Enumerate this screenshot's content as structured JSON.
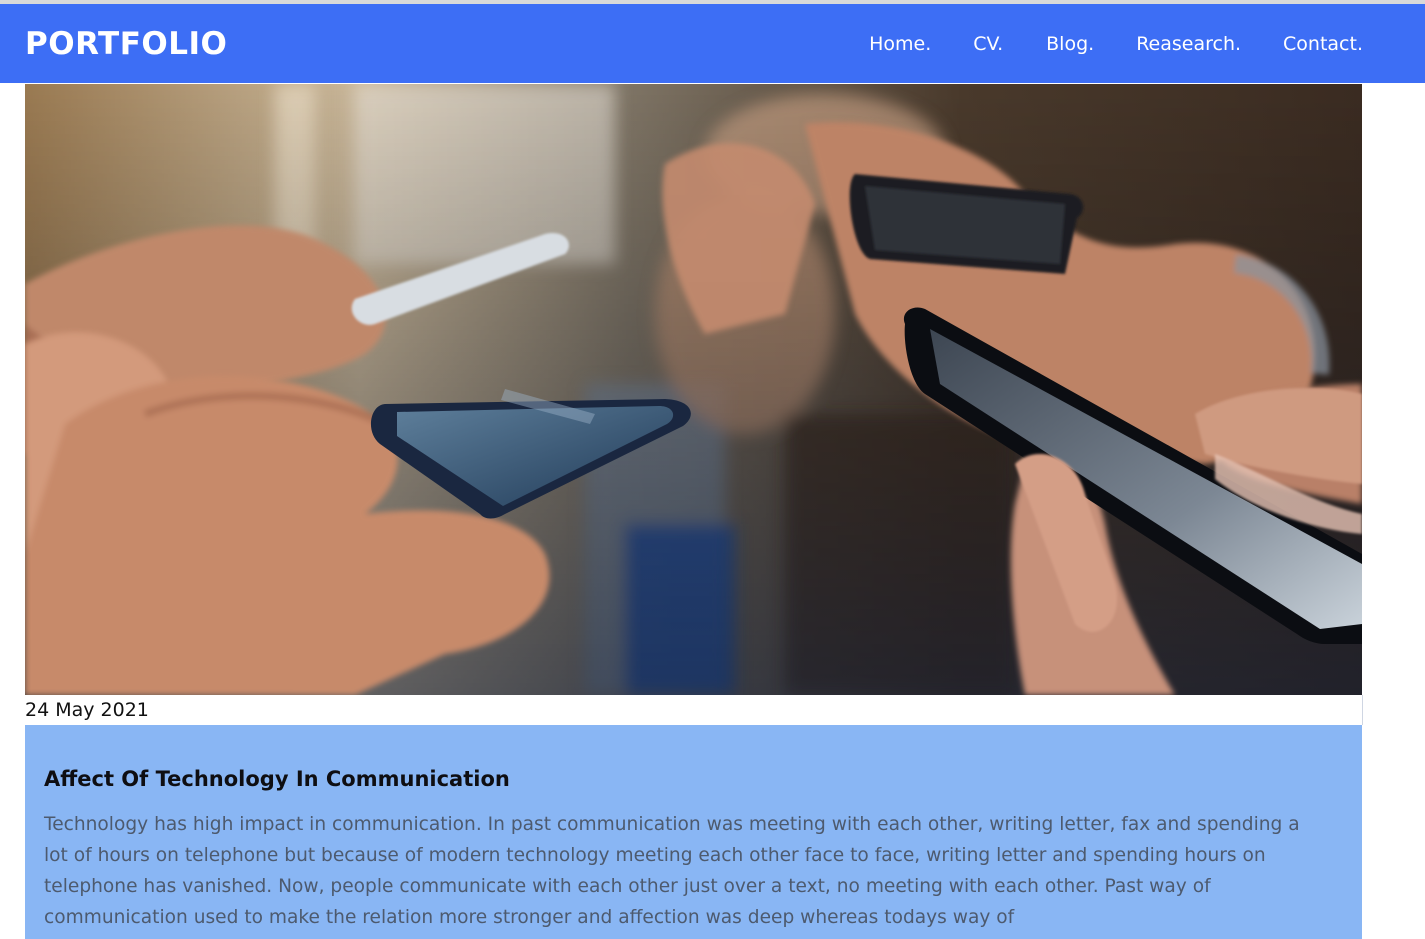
{
  "navbar": {
    "brand": "PORTFOLIO",
    "links": [
      "Home.",
      "CV.",
      "Blog.",
      "Reasearch.",
      "Contact."
    ]
  },
  "post": {
    "date": "24 May 2021",
    "title": "Affect Of Technology In Communication",
    "body": "Technology has high impact in communication. In past communication was meeting with each other, writing letter, fax and spending a lot of hours on telephone but because of modern technology meeting each other face to face, writing letter and spending hours on telephone has vanished. Now, people communicate with each other just over a text, no meeting with each other. Past way of communication used to make the relation more stronger and affection was deep whereas todays way of"
  },
  "colors": {
    "navbar": "#3d6ef5",
    "card": "#89b6f4"
  }
}
